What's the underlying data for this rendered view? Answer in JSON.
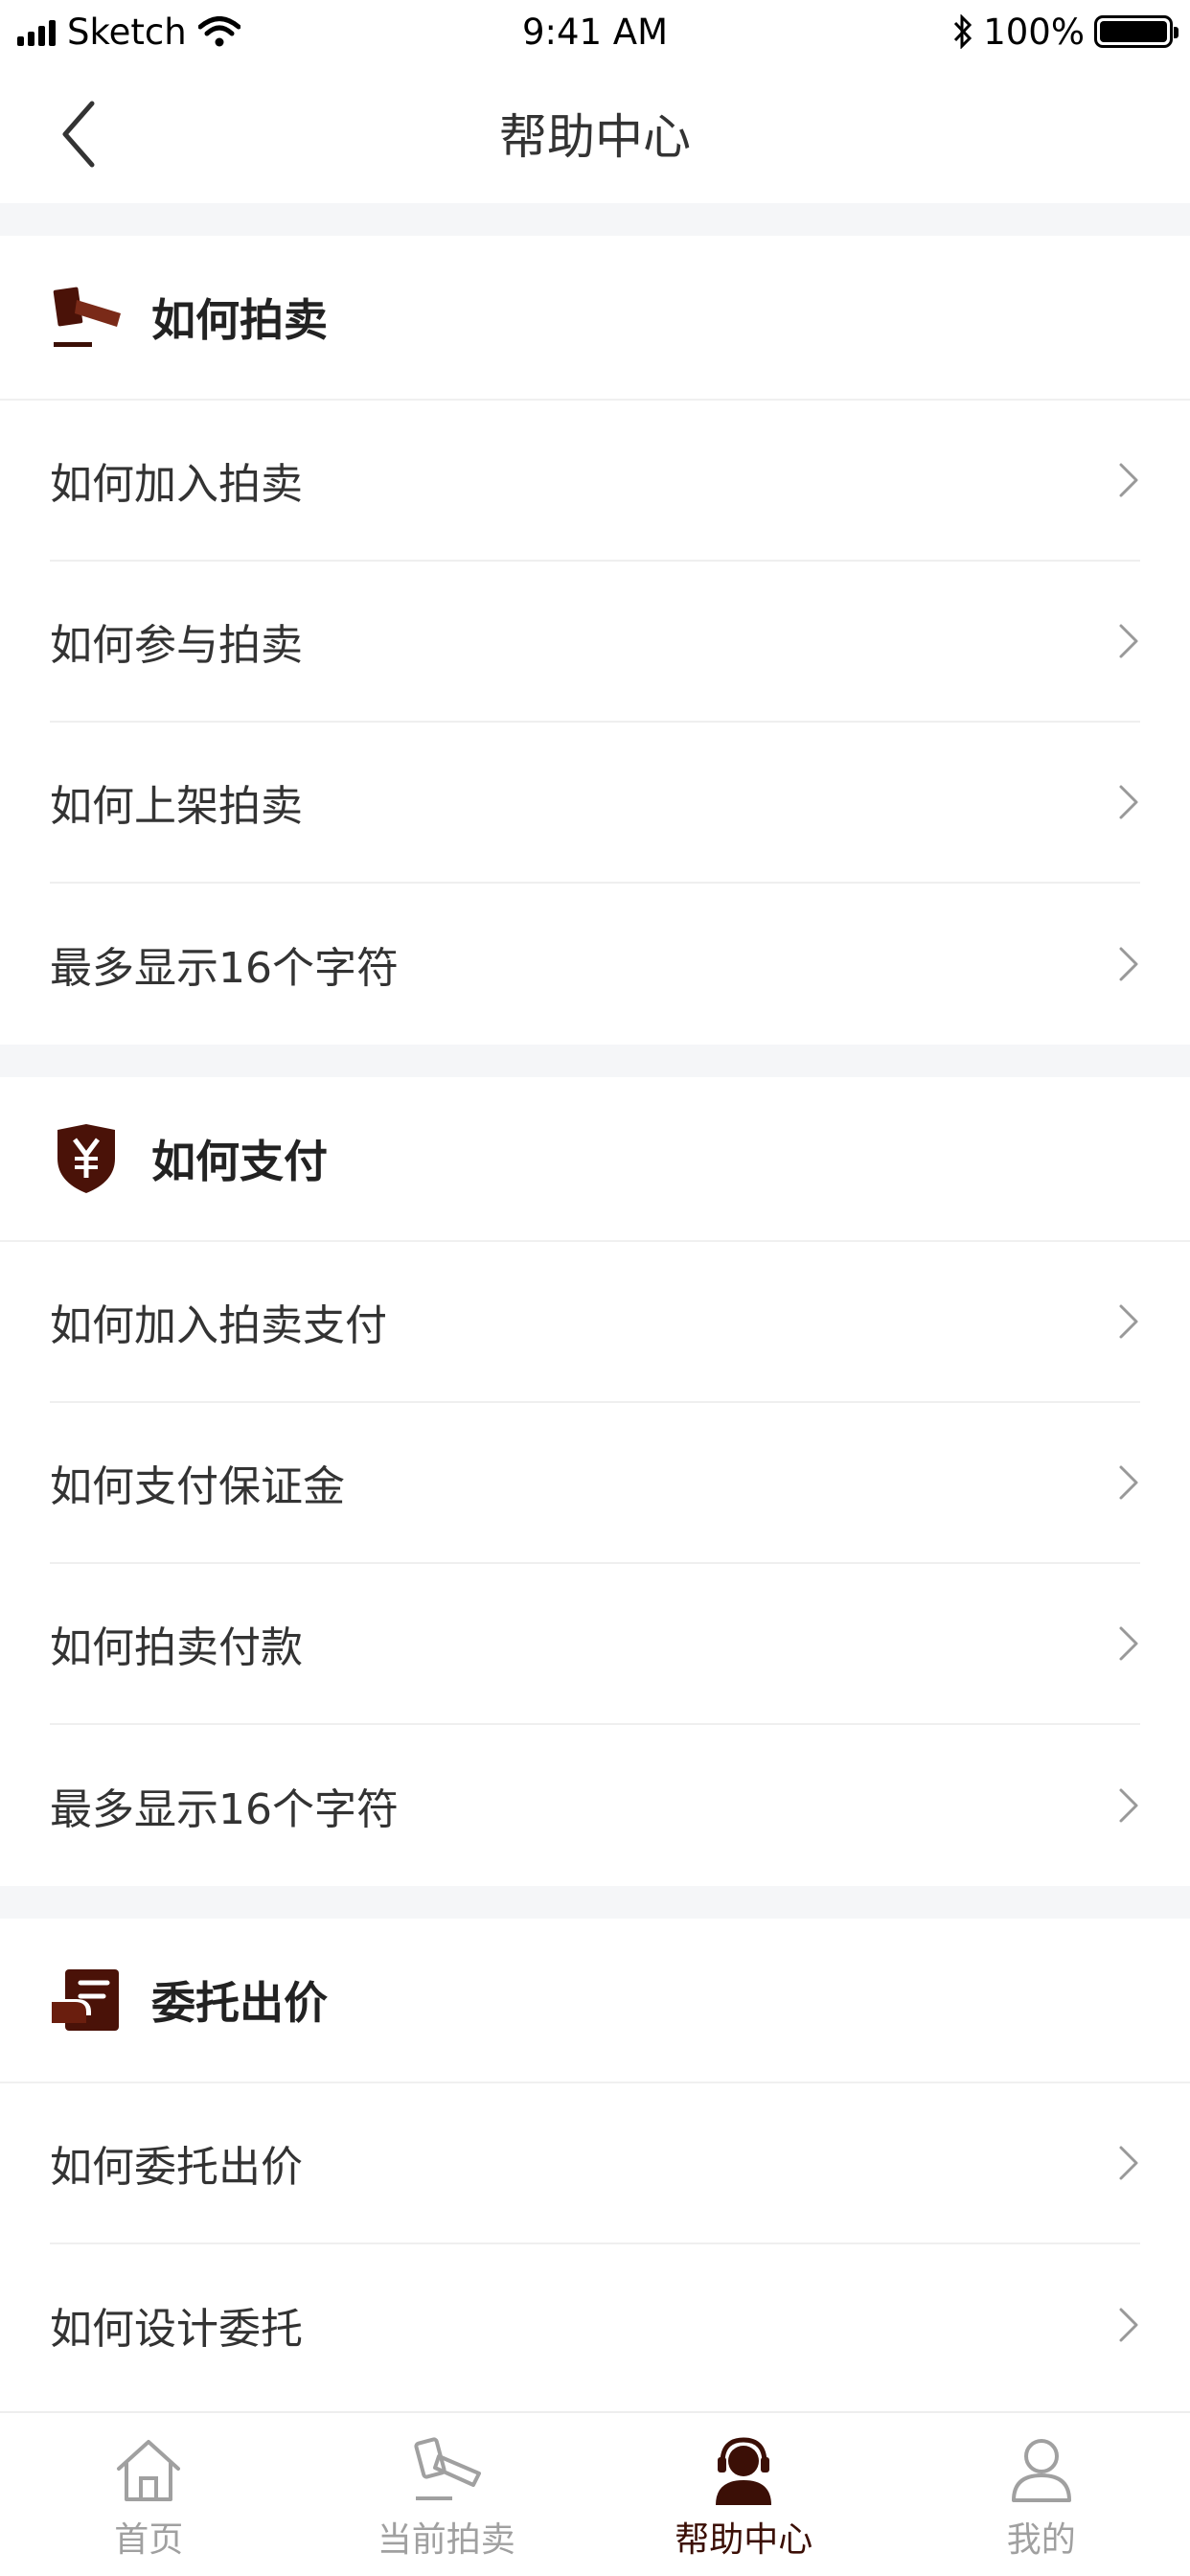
{
  "status_bar": {
    "carrier": "Sketch",
    "time": "9:41 AM",
    "battery": "100%",
    "battery_level": 1.0
  },
  "nav": {
    "title": "帮助中心"
  },
  "colors": {
    "accent": "#3b0f06",
    "section_gap": "#f5f6f8",
    "tab_inactive": "#a0a0a0"
  },
  "sections": [
    {
      "title": "如何拍卖",
      "icon": "auction-hammer-icon",
      "items": [
        "如何加入拍卖",
        "如何参与拍卖",
        "如何上架拍卖",
        "最多显示16个字符"
      ]
    },
    {
      "title": "如何支付",
      "icon": "yen-shield-icon",
      "items": [
        "如何加入拍卖支付",
        "如何支付保证金",
        "如何拍卖付款",
        "最多显示16个字符"
      ]
    },
    {
      "title": "委托出价",
      "icon": "hand-bid-icon",
      "items": [
        "如何委托出价",
        "如何设计委托"
      ]
    }
  ],
  "tabbar": {
    "tabs": [
      {
        "label": "首页",
        "icon": "home-icon",
        "active": false
      },
      {
        "label": "当前拍卖",
        "icon": "auction-hammer-icon",
        "active": false
      },
      {
        "label": "帮助中心",
        "icon": "headset-user-icon",
        "active": true
      },
      {
        "label": "我的",
        "icon": "user-icon",
        "active": false
      }
    ]
  }
}
